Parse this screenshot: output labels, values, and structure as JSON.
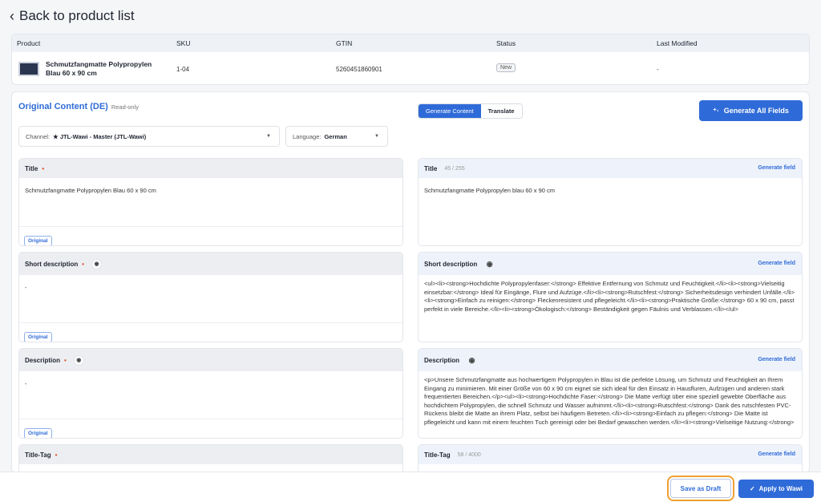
{
  "nav": {
    "back_label": "Back to product list"
  },
  "product_table": {
    "headers": [
      "Product",
      "SKU",
      "GTIN",
      "Status",
      "Last Modified"
    ],
    "row": {
      "name": "Schmutzfangmatte Polypropylen Blau 60 x 90 cm",
      "sku": "1-04",
      "gtin": "5260451860901",
      "status": "New",
      "last_modified": "-"
    }
  },
  "content": {
    "title": "Original Content (DE)",
    "readonly_label": "Read-only",
    "mode_tabs": [
      "Generate Content",
      "Translate"
    ],
    "generate_all_label": "Generate All Fields",
    "channel": {
      "label": "Channel:",
      "value": "★ JTL-Wawi - Master (JTL-Wawi)"
    },
    "language": {
      "label": "Language:",
      "value": "German"
    }
  },
  "original_fields": {
    "title": {
      "label": "Title",
      "value": "Schmutzfangmatte Polypropylen Blau 60 x 90 cm",
      "badge": "Original"
    },
    "short_description": {
      "label": "Short description",
      "value": "-",
      "badge": "Original"
    },
    "description": {
      "label": "Description",
      "value": "-",
      "badge": "Original"
    },
    "title_tag": {
      "label": "Title-Tag"
    }
  },
  "generated_fields": {
    "generate_label": "Generate field",
    "title": {
      "label": "Title",
      "count": "45 / 255",
      "value": "Schmutzfangmatte Polypropylen blau 60 x 90 cm"
    },
    "short_description": {
      "label": "Short description",
      "value": "<ul><li><strong>Hochdichte Polypropylenfaser:</strong> Effektive Entfernung von Schmutz und Feuchtigkeit.</li><li><strong>Vielseitig einsetzbar:</strong> Ideal für Eingänge, Flure und Aufzüge.</li><li><strong>Rutschfest:</strong> Sicherheitsdesign verhindert Unfälle.</li><li><strong>Einfach zu reinigen:</strong> Fleckenresistent und pflegeleicht.</li><li><strong>Praktische Größe:</strong> 60 x 90 cm, passt perfekt in viele Bereiche.</li><li><strong>Ökologisch:</strong> Beständigkeit gegen Fäulnis und Verblassen.</li></ul>"
    },
    "description": {
      "label": "Description",
      "value": "<p>Unsere Schmutzfangmatte aus hochwertigem Polypropylen in Blau ist die perfekte Lösung, um Schmutz und Feuchtigkeit an Ihrem Eingang zu minimieren. Mit einer Größe von 60 x 90 cm eignet sie sich ideal für den Einsatz in Hausfluren, Aufzügen und anderen stark frequentierten Bereichen.</p><ul><li><strong>Hochdichte Faser:</strong> Die Matte verfügt über eine speziell gewebte Oberfläche aus hochdichtem Polypropylen, die schnell Schmutz und Wasser aufnimmt.</li><li><strong>Rutschfest:</strong> Dank des rutschfesten PVC-Rückens bleibt die Matte an ihrem Platz, selbst bei häufigem Betreten.</li><li><strong>Einfach zu pflegen:</strong> Die Matte ist pflegeleicht und kann mit einem feuchten Tuch gereinigt oder bei Bedarf gewaschen werden.</li><li><strong>Vielseitige Nutzung:</strong>"
    },
    "title_tag": {
      "label": "Title-Tag",
      "count": "58 / 4000"
    }
  },
  "actions": {
    "save_draft": "Save as Draft",
    "apply": "Apply to Wawi"
  },
  "colors": {
    "accent": "#2f6bd8",
    "required": "#e2502a",
    "highlight": "#f0a030"
  }
}
